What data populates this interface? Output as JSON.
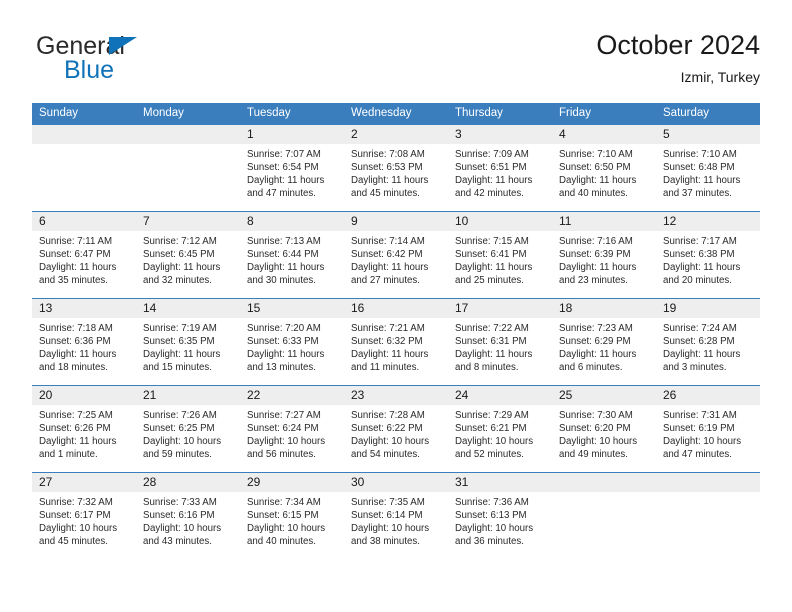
{
  "brand": {
    "name_part1": "General",
    "name_part2": "Blue",
    "triangle_color": "#1072b8"
  },
  "header": {
    "title": "October 2024",
    "subtitle": "Izmir, Turkey"
  },
  "theme": {
    "header_blue": "#3a7ebe",
    "daynum_band": "#eeeeee",
    "text": "#1a1a1a"
  },
  "weekdays": [
    "Sunday",
    "Monday",
    "Tuesday",
    "Wednesday",
    "Thursday",
    "Friday",
    "Saturday"
  ],
  "weeks": [
    [
      {
        "day": "",
        "sunrise": "",
        "sunset": "",
        "daylight_line1": "",
        "daylight_line2": ""
      },
      {
        "day": "",
        "sunrise": "",
        "sunset": "",
        "daylight_line1": "",
        "daylight_line2": ""
      },
      {
        "day": "1",
        "sunrise": "Sunrise: 7:07 AM",
        "sunset": "Sunset: 6:54 PM",
        "daylight_line1": "Daylight: 11 hours",
        "daylight_line2": "and 47 minutes."
      },
      {
        "day": "2",
        "sunrise": "Sunrise: 7:08 AM",
        "sunset": "Sunset: 6:53 PM",
        "daylight_line1": "Daylight: 11 hours",
        "daylight_line2": "and 45 minutes."
      },
      {
        "day": "3",
        "sunrise": "Sunrise: 7:09 AM",
        "sunset": "Sunset: 6:51 PM",
        "daylight_line1": "Daylight: 11 hours",
        "daylight_line2": "and 42 minutes."
      },
      {
        "day": "4",
        "sunrise": "Sunrise: 7:10 AM",
        "sunset": "Sunset: 6:50 PM",
        "daylight_line1": "Daylight: 11 hours",
        "daylight_line2": "and 40 minutes."
      },
      {
        "day": "5",
        "sunrise": "Sunrise: 7:10 AM",
        "sunset": "Sunset: 6:48 PM",
        "daylight_line1": "Daylight: 11 hours",
        "daylight_line2": "and 37 minutes."
      }
    ],
    [
      {
        "day": "6",
        "sunrise": "Sunrise: 7:11 AM",
        "sunset": "Sunset: 6:47 PM",
        "daylight_line1": "Daylight: 11 hours",
        "daylight_line2": "and 35 minutes."
      },
      {
        "day": "7",
        "sunrise": "Sunrise: 7:12 AM",
        "sunset": "Sunset: 6:45 PM",
        "daylight_line1": "Daylight: 11 hours",
        "daylight_line2": "and 32 minutes."
      },
      {
        "day": "8",
        "sunrise": "Sunrise: 7:13 AM",
        "sunset": "Sunset: 6:44 PM",
        "daylight_line1": "Daylight: 11 hours",
        "daylight_line2": "and 30 minutes."
      },
      {
        "day": "9",
        "sunrise": "Sunrise: 7:14 AM",
        "sunset": "Sunset: 6:42 PM",
        "daylight_line1": "Daylight: 11 hours",
        "daylight_line2": "and 27 minutes."
      },
      {
        "day": "10",
        "sunrise": "Sunrise: 7:15 AM",
        "sunset": "Sunset: 6:41 PM",
        "daylight_line1": "Daylight: 11 hours",
        "daylight_line2": "and 25 minutes."
      },
      {
        "day": "11",
        "sunrise": "Sunrise: 7:16 AM",
        "sunset": "Sunset: 6:39 PM",
        "daylight_line1": "Daylight: 11 hours",
        "daylight_line2": "and 23 minutes."
      },
      {
        "day": "12",
        "sunrise": "Sunrise: 7:17 AM",
        "sunset": "Sunset: 6:38 PM",
        "daylight_line1": "Daylight: 11 hours",
        "daylight_line2": "and 20 minutes."
      }
    ],
    [
      {
        "day": "13",
        "sunrise": "Sunrise: 7:18 AM",
        "sunset": "Sunset: 6:36 PM",
        "daylight_line1": "Daylight: 11 hours",
        "daylight_line2": "and 18 minutes."
      },
      {
        "day": "14",
        "sunrise": "Sunrise: 7:19 AM",
        "sunset": "Sunset: 6:35 PM",
        "daylight_line1": "Daylight: 11 hours",
        "daylight_line2": "and 15 minutes."
      },
      {
        "day": "15",
        "sunrise": "Sunrise: 7:20 AM",
        "sunset": "Sunset: 6:33 PM",
        "daylight_line1": "Daylight: 11 hours",
        "daylight_line2": "and 13 minutes."
      },
      {
        "day": "16",
        "sunrise": "Sunrise: 7:21 AM",
        "sunset": "Sunset: 6:32 PM",
        "daylight_line1": "Daylight: 11 hours",
        "daylight_line2": "and 11 minutes."
      },
      {
        "day": "17",
        "sunrise": "Sunrise: 7:22 AM",
        "sunset": "Sunset: 6:31 PM",
        "daylight_line1": "Daylight: 11 hours",
        "daylight_line2": "and 8 minutes."
      },
      {
        "day": "18",
        "sunrise": "Sunrise: 7:23 AM",
        "sunset": "Sunset: 6:29 PM",
        "daylight_line1": "Daylight: 11 hours",
        "daylight_line2": "and 6 minutes."
      },
      {
        "day": "19",
        "sunrise": "Sunrise: 7:24 AM",
        "sunset": "Sunset: 6:28 PM",
        "daylight_line1": "Daylight: 11 hours",
        "daylight_line2": "and 3 minutes."
      }
    ],
    [
      {
        "day": "20",
        "sunrise": "Sunrise: 7:25 AM",
        "sunset": "Sunset: 6:26 PM",
        "daylight_line1": "Daylight: 11 hours",
        "daylight_line2": "and 1 minute."
      },
      {
        "day": "21",
        "sunrise": "Sunrise: 7:26 AM",
        "sunset": "Sunset: 6:25 PM",
        "daylight_line1": "Daylight: 10 hours",
        "daylight_line2": "and 59 minutes."
      },
      {
        "day": "22",
        "sunrise": "Sunrise: 7:27 AM",
        "sunset": "Sunset: 6:24 PM",
        "daylight_line1": "Daylight: 10 hours",
        "daylight_line2": "and 56 minutes."
      },
      {
        "day": "23",
        "sunrise": "Sunrise: 7:28 AM",
        "sunset": "Sunset: 6:22 PM",
        "daylight_line1": "Daylight: 10 hours",
        "daylight_line2": "and 54 minutes."
      },
      {
        "day": "24",
        "sunrise": "Sunrise: 7:29 AM",
        "sunset": "Sunset: 6:21 PM",
        "daylight_line1": "Daylight: 10 hours",
        "daylight_line2": "and 52 minutes."
      },
      {
        "day": "25",
        "sunrise": "Sunrise: 7:30 AM",
        "sunset": "Sunset: 6:20 PM",
        "daylight_line1": "Daylight: 10 hours",
        "daylight_line2": "and 49 minutes."
      },
      {
        "day": "26",
        "sunrise": "Sunrise: 7:31 AM",
        "sunset": "Sunset: 6:19 PM",
        "daylight_line1": "Daylight: 10 hours",
        "daylight_line2": "and 47 minutes."
      }
    ],
    [
      {
        "day": "27",
        "sunrise": "Sunrise: 7:32 AM",
        "sunset": "Sunset: 6:17 PM",
        "daylight_line1": "Daylight: 10 hours",
        "daylight_line2": "and 45 minutes."
      },
      {
        "day": "28",
        "sunrise": "Sunrise: 7:33 AM",
        "sunset": "Sunset: 6:16 PM",
        "daylight_line1": "Daylight: 10 hours",
        "daylight_line2": "and 43 minutes."
      },
      {
        "day": "29",
        "sunrise": "Sunrise: 7:34 AM",
        "sunset": "Sunset: 6:15 PM",
        "daylight_line1": "Daylight: 10 hours",
        "daylight_line2": "and 40 minutes."
      },
      {
        "day": "30",
        "sunrise": "Sunrise: 7:35 AM",
        "sunset": "Sunset: 6:14 PM",
        "daylight_line1": "Daylight: 10 hours",
        "daylight_line2": "and 38 minutes."
      },
      {
        "day": "31",
        "sunrise": "Sunrise: 7:36 AM",
        "sunset": "Sunset: 6:13 PM",
        "daylight_line1": "Daylight: 10 hours",
        "daylight_line2": "and 36 minutes."
      },
      {
        "day": "",
        "sunrise": "",
        "sunset": "",
        "daylight_line1": "",
        "daylight_line2": ""
      },
      {
        "day": "",
        "sunrise": "",
        "sunset": "",
        "daylight_line1": "",
        "daylight_line2": ""
      }
    ]
  ]
}
